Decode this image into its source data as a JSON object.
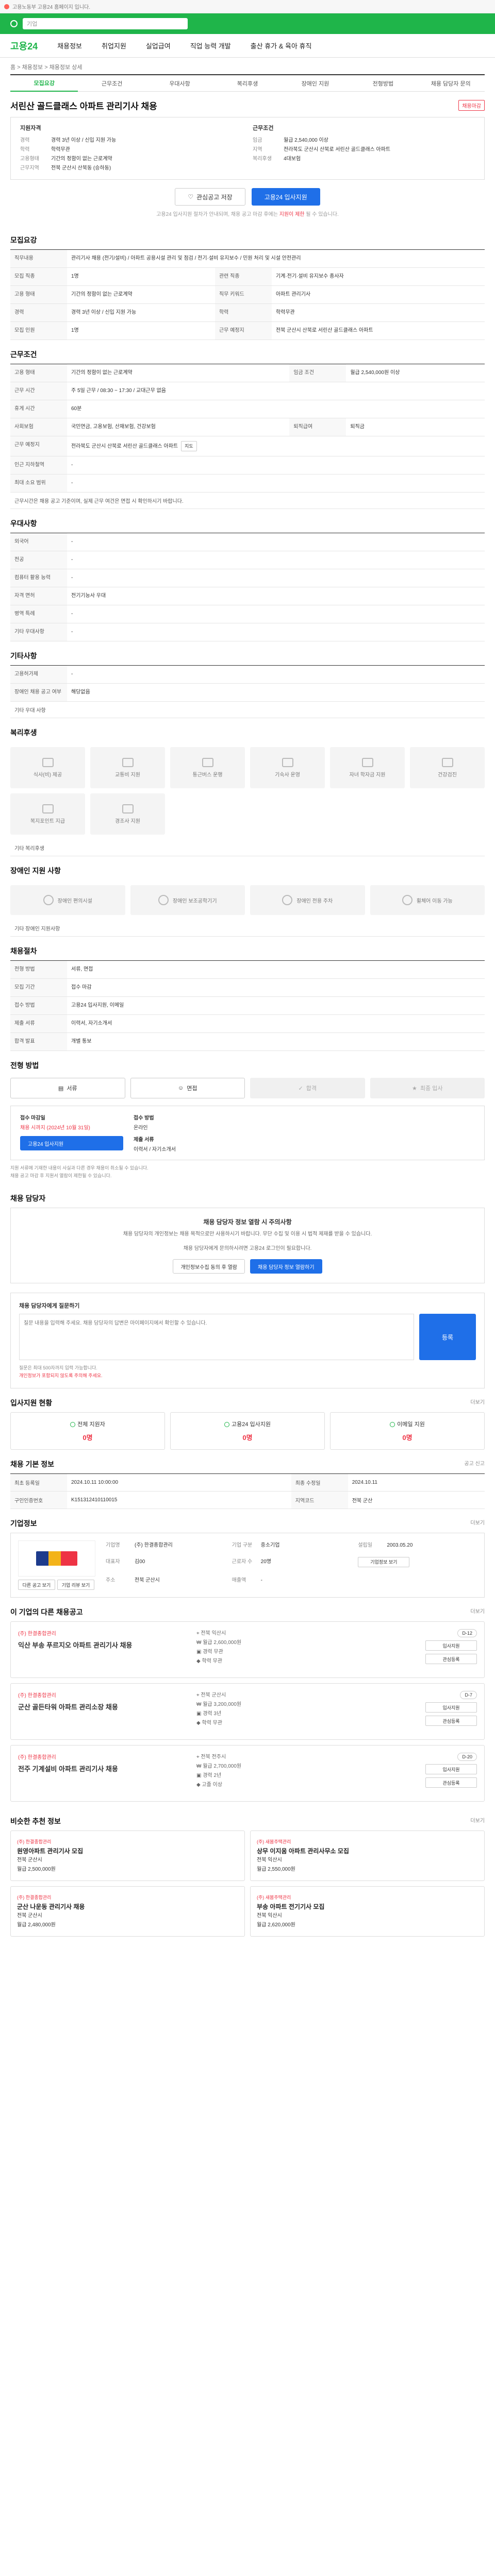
{
  "topbar": {
    "notice": "고용노동부 고용24 홈페이지 입니다."
  },
  "header": {
    "search_placeholder": "기업"
  },
  "nav": {
    "logo_prefix": "고용",
    "logo_suffix": "24",
    "items": [
      "채용정보",
      "취업지원",
      "실업급여",
      "직업 능력 개발",
      "출산 휴가 & 육아 휴직"
    ]
  },
  "crumb": "홈 > 채용정보 > 채용정보 상세",
  "tabs": [
    "모집요강",
    "근무조건",
    "우대사항",
    "복리후생",
    "장애인 지원",
    "전형방법",
    "채용 담당자 문의"
  ],
  "job": {
    "title": "서린산 골드클래스 아파트 관리기사 채용",
    "badge": "채용마감"
  },
  "summary": {
    "left_title": "지원자격",
    "left": [
      {
        "k": "경력",
        "v": "경력 3년 이상 / 신입 지원 가능"
      },
      {
        "k": "학력",
        "v": "학력무관"
      },
      {
        "k": "고용형태",
        "v": "기간의 정함이 없는 근로계약"
      },
      {
        "k": "근무지역",
        "v": "전북 군산시 산북동 (승하동)"
      }
    ],
    "right_title": "근무조건",
    "right": [
      {
        "k": "임금",
        "v": "월급 2,540,000 이상"
      },
      {
        "k": "지역",
        "v": "전라북도 군산시 산북로 서린산 골드클래스 아파트"
      },
      {
        "k": "복리후생",
        "v": "4대보험"
      }
    ]
  },
  "actions": {
    "save": "관심공고 저장",
    "apply": "고용24 입사지원"
  },
  "notice_line": {
    "text": "고용24 입사지원 절차가 안내되며, 채용 공고 마감 후에는",
    "highlight": "지원이 제한",
    "tail": "될 수 있습니다."
  },
  "recruit": {
    "title": "모집요강",
    "rows": [
      {
        "k": "직무내용",
        "v": "관리기사 채용 (전기/설비) / 아파트 공용시설 관리 및 점검 / 전기·설비 유지보수 / 민원 처리 및 시설 안전관리"
      },
      {
        "k": "모집 직종",
        "v": "1명"
      },
      {
        "k": "관련 직종",
        "v": "기계·전기·설비 유지보수 종사자"
      },
      {
        "k": "고용 형태",
        "v": "기간의 정함이 없는 근로계약"
      },
      {
        "k": "직무 키워드",
        "v": "아파트 관리기사"
      },
      {
        "k": "경력",
        "v": "경력 3년 이상 / 신입 지원 가능"
      },
      {
        "k": "학력",
        "v": "학력무관"
      },
      {
        "k": "모집 인원",
        "v": "1명"
      },
      {
        "k": "근무 예정지",
        "v": "전북 군산시 산북로 서린산 골드클래스 아파트"
      }
    ]
  },
  "work": {
    "title": "근무조건",
    "rows": [
      {
        "k": "고용 형태",
        "v": "기간의 정함이 없는 근로계약",
        "k2": "임금 조건",
        "v2": "월급 2,540,000원 이상"
      },
      {
        "k": "근무 시간",
        "v": "주 5일 근무 / 08:30 ~ 17:30 / 교대근무 없음"
      },
      {
        "k": "휴게 시간",
        "v": "60분"
      },
      {
        "k": "사회보험",
        "v": "국민연금, 고용보험, 산재보험, 건강보험",
        "k2": "퇴직급여",
        "v2": "퇴직금"
      },
      {
        "k": "근무 예정지",
        "v": "전라북도 군산시 산북로 서린산 골드클래스 아파트"
      },
      {
        "k": "인근 지하철역",
        "v": "-"
      },
      {
        "k": "최대 소요 범위",
        "v": "-"
      }
    ],
    "footnote": "근무시간은 채용 공고 기준이며, 실제 근무 여건은 면접 시 확인하시기 바랍니다."
  },
  "prefer": {
    "title": "우대사항",
    "rows": [
      {
        "k": "외국어",
        "v": "-"
      },
      {
        "k": "전공",
        "v": "-"
      },
      {
        "k": "컴퓨터 활용 능력",
        "v": "-"
      },
      {
        "k": "자격 면허",
        "v": "전기기능사 우대"
      },
      {
        "k": "병역 특례",
        "v": "-"
      },
      {
        "k": "기타 우대사항",
        "v": "-"
      }
    ]
  },
  "etc": {
    "title": "기타사항",
    "rows": [
      {
        "k": "고용허가제",
        "v": "-"
      },
      {
        "k": "장애인 채용 공고 여부",
        "v": "해당없음"
      }
    ],
    "note": "기타 우대 사항"
  },
  "welfare": {
    "title": "복리후생",
    "items": [
      "식사(비) 제공",
      "교통비 지원",
      "통근버스 운행",
      "기숙사 운영",
      "자녀 학자금 지원",
      "건강검진",
      "복지포인트 지급",
      "경조사 지원"
    ],
    "note": "기타 복리후생"
  },
  "barrier": {
    "title": "장애인 지원 사항",
    "items": [
      "장애인 편의시설",
      "장애인 보조공학기기",
      "장애인 전용 주차",
      "휠체어 이동 가능"
    ],
    "note": "기타 장애인 지원사항"
  },
  "employ": {
    "title": "채용절차",
    "rows": [
      {
        "k": "전형 방법",
        "v": "서류, 면접"
      },
      {
        "k": "모집 기간",
        "v": "접수 마감"
      },
      {
        "k": "접수 방법",
        "v": "고용24 입사지원, 이메일"
      },
      {
        "k": "제출 서류",
        "v": "이력서, 자기소개서"
      },
      {
        "k": "합격 발표",
        "v": "개별 통보"
      }
    ]
  },
  "process": {
    "title": "전형 방법",
    "steps": [
      "서류",
      "면접",
      "합격",
      "최종 입사"
    ]
  },
  "apply": {
    "deadline_label": "접수 마감일",
    "deadline": "채용 시까지 (2024년 10월 31일)",
    "apply_btn": "고용24 입사지원",
    "method_label": "접수 방법",
    "method": "온라인",
    "submit_label": "제출 서류",
    "submit": "이력서 / 자기소개서",
    "bullets": [
      "지원 서류에 기재한 내용이 사실과 다른 경우 채용이 취소될 수 있습니다.",
      "채용 공고 마감 후 지원서 열람이 제한될 수 있습니다."
    ]
  },
  "manager": {
    "title": "채용 담당자",
    "box_title": "채용 담당자 정보 열람 시 주의사항",
    "box_desc": "채용 담당자의 개인정보는 채용 목적으로만 사용하시기 바랍니다. 무단 수집 및 이용 시 법적 제재를 받을 수 있습니다.",
    "box_desc2": "채용 담당자에게 문의하시려면 고용24 로그인이 필요합니다.",
    "btn1": "개인정보수집 동의 후 열람",
    "btn2": "채용 담당자 정보 열람하기"
  },
  "inquiry": {
    "head": "채용 담당자에게 질문하기",
    "placeholder": "질문 내용을 입력해 주세요. 채용 담당자의 답변은 마이페이지에서 확인할 수 있습니다.",
    "send": "등록",
    "foot1": "질문은 최대 500자까지 입력 가능합니다.",
    "foot2": "개인정보가 포함되지 않도록 주의해 주세요."
  },
  "stats": {
    "title": "입사지원 현황",
    "more": "더보기",
    "items": [
      {
        "label": "전체 지원자",
        "n": "0명"
      },
      {
        "label": "고용24 입사지원",
        "n": "0명"
      },
      {
        "label": "이메일 지원",
        "n": "0명"
      }
    ]
  },
  "info": {
    "title": "채용 기본 정보",
    "more": "공고 신고",
    "rows": [
      {
        "k": "최초 등록일",
        "v": "2024.10.11 10:00:00",
        "k2": "최종 수정일",
        "v2": "2024.10.11"
      },
      {
        "k": "구인인증번호",
        "v": "K151312410110015",
        "k2": "지역코드",
        "v2": "전북 군산"
      }
    ]
  },
  "company": {
    "title": "기업정보",
    "more": "더보기",
    "name_label": "기업명",
    "name": "(주) 한결종합관리",
    "type_label": "기업 구분",
    "type": "중소기업",
    "rep_label": "대표자",
    "rep": "김00",
    "addr_label": "주소",
    "addr": "전북 군산시",
    "emp_label": "근로자 수",
    "emp": "20명",
    "sales_label": "매출액",
    "sales": "-",
    "founded_label": "설립일",
    "founded": "2003.05.20",
    "btn_info": "기업정보 보기",
    "btn_other": "다른 공고 보기",
    "btn_review": "기업 리뷰 보기"
  },
  "other_jobs": {
    "title": "이 기업의 다른 채용공고",
    "more": "더보기",
    "items": [
      {
        "co": "(주) 한결종합관리",
        "title": "익산 부송 푸르지오 아파트 관리기사 채용",
        "loc": "전북 익산시",
        "pay": "월급 2,600,000원",
        "exp": "경력 무관",
        "edu": "학력 무관",
        "deadline": "D-12",
        "apply": "입사지원",
        "save": "관심등록"
      },
      {
        "co": "(주) 한결종합관리",
        "title": "군산 골든타워 아파트 관리소장 채용",
        "loc": "전북 군산시",
        "pay": "월급 3,200,000원",
        "exp": "경력 3년",
        "edu": "학력 무관",
        "deadline": "D-7",
        "apply": "입사지원",
        "save": "관심등록"
      },
      {
        "co": "(주) 한결종합관리",
        "title": "전주 기계설비 아파트 관리기사 채용",
        "loc": "전북 전주시",
        "pay": "월급 2,700,000원",
        "exp": "경력 2년",
        "edu": "고졸 이상",
        "deadline": "D-20",
        "apply": "입사지원",
        "save": "관심등록"
      }
    ]
  },
  "recent": {
    "title": "비슷한 추천 정보",
    "more": "더보기",
    "items": [
      {
        "co": "(주) 한결종합관리",
        "title": "원영아파트 관리기사 모집",
        "loc": "전북 군산시",
        "pay": "월급 2,500,000원"
      },
      {
        "co": "(주) 새봄주택관리",
        "title": "상무 이지움 아파트 관리사무소 모집",
        "loc": "전북 익산시",
        "pay": "월급 2,550,000원"
      },
      {
        "co": "(주) 한결종합관리",
        "title": "군산 나운동 관리기사 채용",
        "loc": "전북 군산시",
        "pay": "월급 2,480,000원"
      },
      {
        "co": "(주) 새봄주택관리",
        "title": "부송 아파트 전기기사 모집",
        "loc": "전북 익산시",
        "pay": "월급 2,620,000원"
      }
    ]
  }
}
